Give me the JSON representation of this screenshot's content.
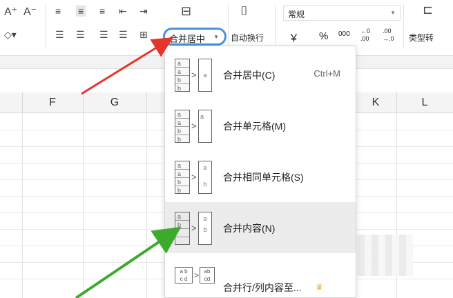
{
  "ribbon": {
    "font_size_up_icon": "font-size-increase-icon",
    "font_size_down_icon": "font-size-decrease-icon",
    "merge_button_label": "合并居中",
    "wrap_text_label": "自动换行",
    "number_format_value": "常规",
    "currency_symbol": "￥",
    "percent_symbol": "%",
    "thousands_symbol": "000",
    "inc_decimal_top": "←0",
    "inc_decimal_bottom": ".00",
    "dec_decimal_top": ".00",
    "dec_decimal_bottom": "→.0",
    "type_convert_label": "类型转"
  },
  "columns": [
    "F",
    "G",
    "K",
    "L"
  ],
  "menu": {
    "items": [
      {
        "label": "合并居中(C)",
        "shortcut": "Ctrl+M"
      },
      {
        "label": "合并单元格(M)",
        "shortcut": ""
      },
      {
        "label": "合并相同单元格(S)",
        "shortcut": ""
      },
      {
        "label": "合并内容(N)",
        "shortcut": ""
      },
      {
        "label": "合并行/列内容至...",
        "shortcut": ""
      }
    ]
  },
  "colors": {
    "highlight_circle": "#4a90e2",
    "red_arrow": "#e8332a",
    "green_arrow": "#3daa2e",
    "menu_hover": "#ececec"
  }
}
